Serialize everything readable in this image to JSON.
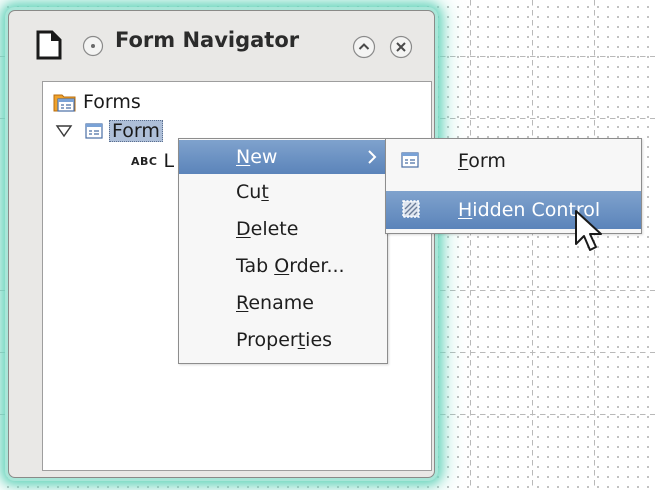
{
  "window": {
    "title": "Form Navigator",
    "icons": {
      "document": "document-icon",
      "menu": "window-menu-icon",
      "shade": "shade-up-icon",
      "close": "close-icon"
    }
  },
  "tree": {
    "root": {
      "label": "Forms",
      "icon": "forms-folder-icon"
    },
    "form": {
      "label": "Form",
      "icon": "form-icon",
      "expanded": true,
      "selected": true
    },
    "control": {
      "prefix": "ABC",
      "label_visible": "L"
    }
  },
  "context_menu": {
    "items": [
      {
        "id": "new",
        "pre": "",
        "key": "N",
        "post": "ew",
        "submenu": true,
        "highlighted": true
      },
      {
        "id": "cut",
        "pre": "Cu",
        "key": "t",
        "post": ""
      },
      {
        "id": "delete",
        "pre": "",
        "key": "D",
        "post": "elete"
      },
      {
        "id": "tab-order",
        "pre": "Tab ",
        "key": "O",
        "post": "rder..."
      },
      {
        "id": "rename",
        "pre": "",
        "key": "R",
        "post": "ename"
      },
      {
        "id": "properties",
        "pre": "Proper",
        "key": "t",
        "post": "ies"
      }
    ]
  },
  "submenu": {
    "items": [
      {
        "id": "form",
        "pre": "",
        "key": "F",
        "post": "orm",
        "icon": "form-icon"
      },
      {
        "id": "hidden-control",
        "pre": "",
        "key": "H",
        "post": "idden Control",
        "icon": "hidden-control-icon",
        "highlighted": true
      }
    ]
  },
  "colors": {
    "highlight": "#6a8fc2",
    "glow": "#6fd6bf",
    "selection": "#aebfd8"
  }
}
